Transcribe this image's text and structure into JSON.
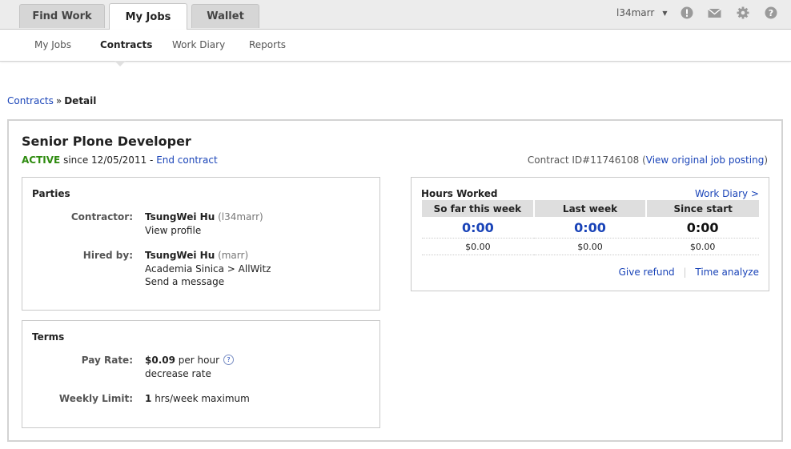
{
  "nav": {
    "tabs": [
      {
        "label": "Find Work"
      },
      {
        "label": "My Jobs"
      },
      {
        "label": "Wallet"
      }
    ],
    "username": "l34marr",
    "icons": [
      "alert-icon",
      "mail-icon",
      "gear-icon",
      "help-icon"
    ]
  },
  "subnav": {
    "items": [
      {
        "label": "My Jobs"
      },
      {
        "label": "Contracts"
      },
      {
        "label": "Work Diary"
      },
      {
        "label": "Reports"
      }
    ]
  },
  "breadcrumb": {
    "parent": "Contracts",
    "separator": "»",
    "current": "Detail"
  },
  "contract": {
    "title": "Senior Plone Developer",
    "status": "ACTIVE",
    "since": "since 12/05/2011 -",
    "end_link": "End contract",
    "id_text": "Contract ID#11746108 (",
    "view_posting": "View original job posting",
    "id_close": ")"
  },
  "parties": {
    "title": "Parties",
    "contractor_label": "Contractor:",
    "contractor_name": "TsungWei Hu",
    "contractor_handle": "(l34marr)",
    "view_profile": "View profile",
    "hired_label": "Hired by:",
    "hired_name": "TsungWei Hu",
    "hired_handle": "(marr)",
    "company": "Academia Sinica > AllWitz",
    "send_message": "Send a message"
  },
  "terms": {
    "title": "Terms",
    "pay_label": "Pay Rate:",
    "pay_amount": "$0.09",
    "pay_unit": "per hour",
    "help_glyph": "?",
    "decrease": "decrease rate",
    "limit_label": "Weekly Limit:",
    "limit_value": "1",
    "limit_unit": "hrs/week maximum"
  },
  "hours": {
    "title": "Hours Worked",
    "work_diary_link": "Work Diary >",
    "columns": [
      "So far this week",
      "Last week",
      "Since start"
    ],
    "hours": [
      "0:00",
      "0:00",
      "0:00"
    ],
    "amounts": [
      "$0.00",
      "$0.00",
      "$0.00"
    ],
    "give_refund": "Give refund",
    "divider": "|",
    "time_analyze": "Time analyze"
  },
  "colors": {
    "link": "#1a44b8",
    "active_status": "#2e8b0f"
  }
}
